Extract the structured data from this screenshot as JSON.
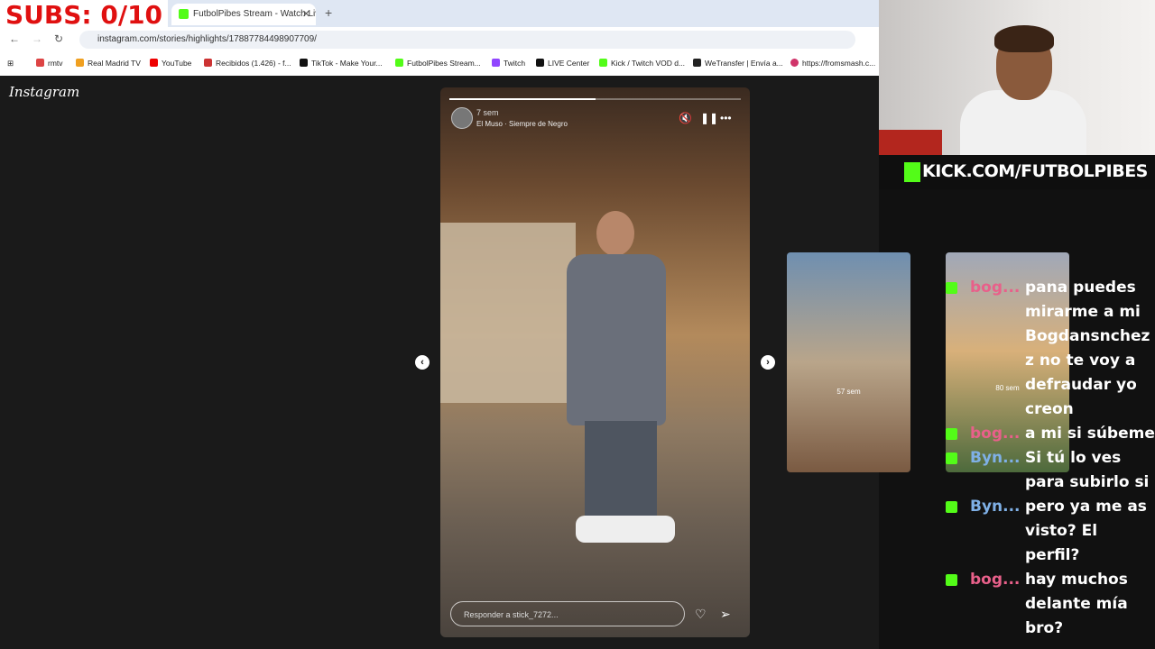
{
  "overlay": {
    "subs": "SUBS: 0/10"
  },
  "browser": {
    "tab_title": "FutbolPibes Stream - Watch Liv",
    "new_tab": "+",
    "url": "instagram.com/stories/highlights/17887784498907709/",
    "bookmarks": [
      "rmtv",
      "Real Madrid TV",
      "YouTube",
      "Recibidos (1.426) - f...",
      "TikTok - Make Your...",
      "FutbolPibes Stream...",
      "Twitch",
      "LIVE Center",
      "Kick / Twitch VOD d...",
      "WeTransfer | Envía a...",
      "https://fromsmash.c..."
    ]
  },
  "instagram": {
    "logo": "Instagram",
    "story": {
      "time": "7 sem",
      "song": "El Muso · Siempre de Negro",
      "reply_placeholder": "Responder a stick_7272...",
      "progress": 0.5
    },
    "next_thumbs": [
      {
        "time": "57 sem"
      },
      {
        "time": "80 sem"
      }
    ]
  },
  "stream": {
    "kick_url": "KICK.COM/FUTBOLPIBES"
  },
  "chat": [
    {
      "user": "bog...",
      "text": "pana puedes mirarme a mi Bogdansnchez z no te voy a defraudar yo creon",
      "color": "pink"
    },
    {
      "user": "bog...",
      "text": "a mi si súbeme",
      "color": "pink"
    },
    {
      "user": "Byn...",
      "text": "Si tú lo ves para subirlo si",
      "color": "blue"
    },
    {
      "user": "Byn...",
      "text": "pero ya me as visto? El perfil?",
      "color": "blue"
    },
    {
      "user": "bog...",
      "text": "hay muchos delante mía bro?",
      "color": "pink"
    }
  ],
  "colors": {
    "kick_green": "#53fc18",
    "subs_red": "#e01010"
  }
}
